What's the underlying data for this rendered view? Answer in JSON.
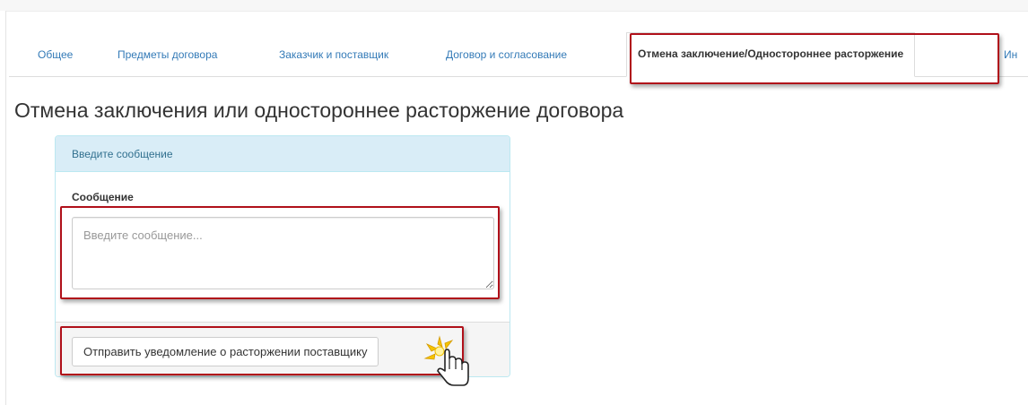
{
  "tabs": [
    {
      "label": "Общее"
    },
    {
      "label": "Предметы договора"
    },
    {
      "label": "Заказчик и поставщик"
    },
    {
      "label": "Договор и согласование"
    },
    {
      "label": "Отмена заключение/Одностороннее расторжение",
      "active": true
    },
    {
      "label": "Ин"
    }
  ],
  "page_title": "Отмена заключения или одностороннее расторжение договора",
  "panel": {
    "heading": "Введите сообщение",
    "field_label": "Сообщение",
    "textarea_placeholder": "Введите сообщение...",
    "textarea_value": "",
    "send_button_label": "Отправить уведомление о расторжении поставщику"
  },
  "colors": {
    "link": "#337ab7",
    "highlight": "#b0101a",
    "panel_heading_bg": "#d9edf7",
    "panel_heading_text": "#31708f"
  },
  "icons": {
    "cursor": "hand-pointer-click-icon",
    "resize": "resize-grip-icon"
  }
}
